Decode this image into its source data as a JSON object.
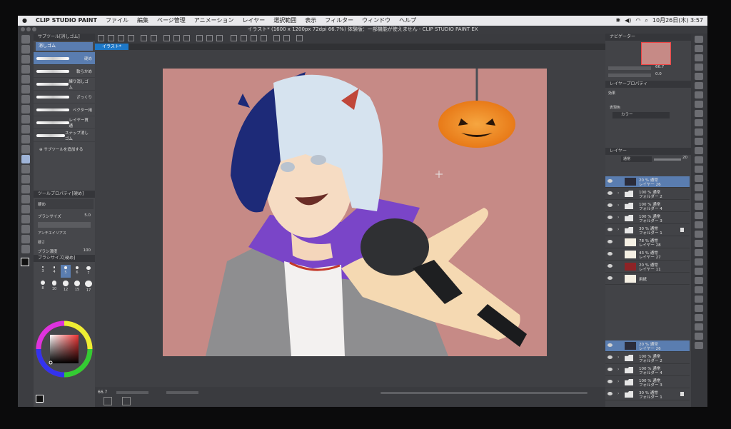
{
  "menubar": {
    "app": "CLIP STUDIO PAINT",
    "items": [
      "ファイル",
      "編集",
      "ページ管理",
      "アニメーション",
      "レイヤー",
      "選択範囲",
      "表示",
      "フィルター",
      "ウィンドウ",
      "ヘルプ"
    ],
    "clock": "10月26日(木) 3:57"
  },
  "window": {
    "title": "イラスト* (1600 x 1200px 72dpi 66.7%) 体験版：一部機能が使えません - CLIP STUDIO PAINT EX",
    "tab": "イラスト*"
  },
  "subtool": {
    "header": "サブツール[消しゴム]",
    "group": "消しゴム",
    "brushes": [
      "硬め",
      "軟らかめ",
      "練り消しゴム",
      "ざっくり",
      "ベクター用",
      "レイヤー貫通",
      "スナップ消しゴム"
    ],
    "add_label": "サブツールを追加する"
  },
  "toolprop": {
    "header": "ツールプロパティ[硬め]",
    "name": "硬め",
    "size_label": "ブラシサイズ",
    "size_value": "5.0",
    "antialias_label": "アンチエイリアス",
    "hard_label": "硬さ",
    "density_label": "ブラシ濃度",
    "density_value": "100"
  },
  "brushsize": {
    "header": "ブラシサイズ[硬め]",
    "sizes": [
      "3",
      "4",
      "5",
      "6",
      "7",
      "8",
      "10",
      "12",
      "15",
      "17"
    ]
  },
  "navigator": {
    "header": "ナビゲーター",
    "zoom": "66.7",
    "rotate": "0.0"
  },
  "layerprop": {
    "header": "レイヤープロパティ",
    "effect_label": "効果",
    "expression_label": "表現色",
    "expression_value": "カラー"
  },
  "layers": {
    "header": "レイヤー",
    "blend": "通常",
    "opacity": "20",
    "items": [
      {
        "mode": "20 % 通常",
        "name": "レイヤー 26",
        "kind": "layer",
        "selected": true
      },
      {
        "mode": "100 % 通常",
        "name": "フォルダー 2",
        "kind": "folder"
      },
      {
        "mode": "100 % 通常",
        "name": "フォルダー 4",
        "kind": "folder"
      },
      {
        "mode": "100 % 通常",
        "name": "フォルダー 3",
        "kind": "folder"
      },
      {
        "mode": "30 % 通常",
        "name": "フォルダー 1",
        "kind": "folder",
        "locked": true
      },
      {
        "mode": "78 % 通常",
        "name": "レイヤー 28",
        "kind": "layer"
      },
      {
        "mode": "43 % 通常",
        "name": "レイヤー 27",
        "kind": "layer"
      },
      {
        "mode": "20 % 通常",
        "name": "レイヤー 11",
        "kind": "layer",
        "thumb": "#8e2326"
      },
      {
        "mode": "",
        "name": "用紙",
        "kind": "paper"
      }
    ],
    "items2": [
      {
        "mode": "20 % 通常",
        "name": "レイヤー 26",
        "kind": "layer",
        "selected": true
      },
      {
        "mode": "100 % 通常",
        "name": "フォルダー 2",
        "kind": "folder"
      },
      {
        "mode": "100 % 通常",
        "name": "フォルダー 4",
        "kind": "folder"
      },
      {
        "mode": "100 % 通常",
        "name": "フォルダー 3",
        "kind": "folder"
      },
      {
        "mode": "30 % 通常",
        "name": "フォルダー 1",
        "kind": "folder",
        "locked": true
      }
    ]
  },
  "status": {
    "zoom": "66.7"
  },
  "colors": {
    "canvas_bg": "#c68a86",
    "hair_dark": "#1d2a78",
    "hair_light": "#d6e3ef",
    "hoodie": "#7a45c8",
    "jacket": "#8d8d8f",
    "pumpkin": "#f08a1e",
    "selection": "#5a7db0",
    "tab_blue": "#1d78c8"
  }
}
